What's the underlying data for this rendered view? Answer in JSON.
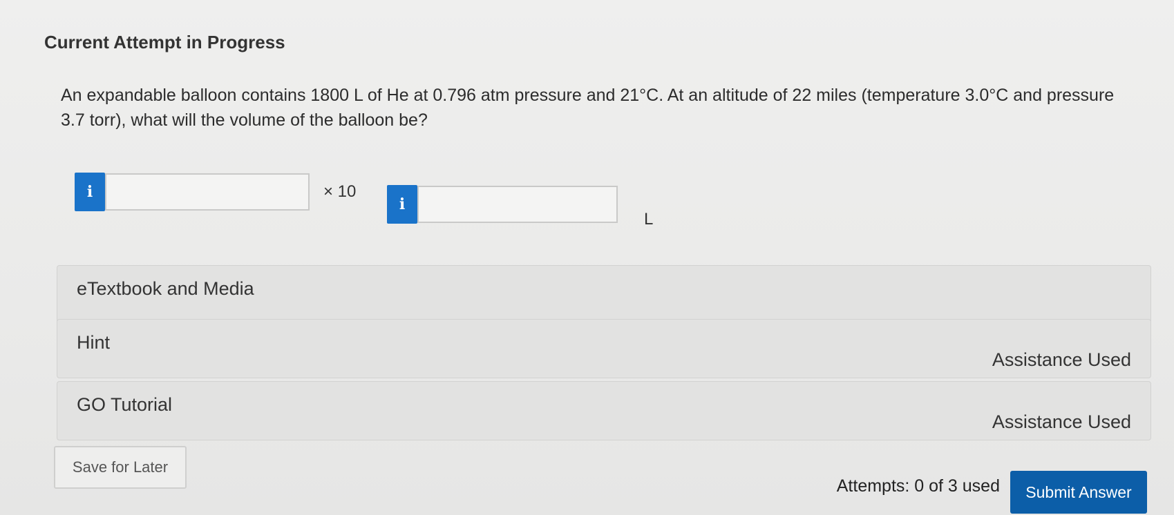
{
  "header": {
    "title": "Current Attempt in Progress"
  },
  "question": {
    "text": "An expandable balloon contains 1800 L of He at 0.796 atm pressure and 21°C. At an altitude of 22 miles (temperature 3.0°C and pressure 3.7 torr), what will the volume of the balloon be?"
  },
  "answer": {
    "info_label": "i",
    "coefficient_value": "",
    "multiplier_label": "× 10",
    "exponent_value": "",
    "unit": "L"
  },
  "resources": [
    {
      "title": "eTextbook and Media",
      "status": ""
    },
    {
      "title": "Hint",
      "status": "Assistance Used"
    },
    {
      "title": "GO Tutorial",
      "status": "Assistance Used"
    }
  ],
  "footer": {
    "save_label": "Save for Later",
    "attempts_text": "Attempts: 0 of 3 used",
    "submit_label": "Submit Answer"
  },
  "colors": {
    "accent": "#1a73c9",
    "submit": "#0c5ea8"
  }
}
